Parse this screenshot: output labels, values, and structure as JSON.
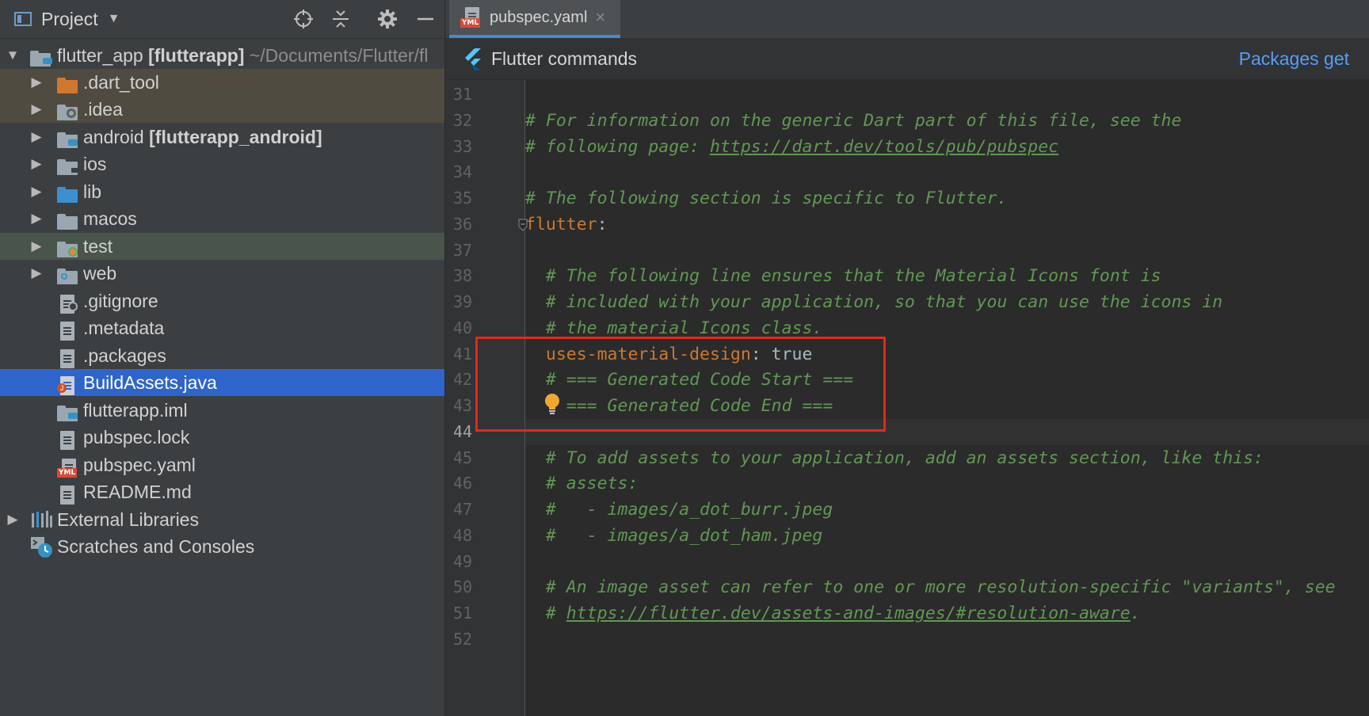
{
  "project_panel": {
    "title": "Project",
    "tools": [
      "locate-icon",
      "collapse-all-icon",
      "settings-icon",
      "hide-icon"
    ],
    "tree": [
      {
        "name": "flutter_app",
        "bold": "[flutterapp]",
        "path": "~/Documents/Flutter/fl",
        "type": "module-folder",
        "expanded": true
      },
      {
        "name": ".dart_tool",
        "type": "folder-excluded"
      },
      {
        "name": ".idea",
        "type": "folder-settings"
      },
      {
        "name": "android",
        "bold": "[flutterapp_android]",
        "type": "module-folder"
      },
      {
        "name": "ios",
        "type": "folder"
      },
      {
        "name": "lib",
        "type": "folder-source"
      },
      {
        "name": "macos",
        "type": "folder"
      },
      {
        "name": "test",
        "type": "folder-test"
      },
      {
        "name": "web",
        "type": "folder-web"
      },
      {
        "name": ".gitignore",
        "type": "file-ignore"
      },
      {
        "name": ".metadata",
        "type": "file"
      },
      {
        "name": ".packages",
        "type": "file"
      },
      {
        "name": "BuildAssets.java",
        "type": "file-java",
        "selected": true
      },
      {
        "name": "flutterapp.iml",
        "type": "file-iml"
      },
      {
        "name": "pubspec.lock",
        "type": "file"
      },
      {
        "name": "pubspec.yaml",
        "type": "file-yaml"
      },
      {
        "name": "README.md",
        "type": "file"
      },
      {
        "name": "External Libraries",
        "type": "libraries"
      },
      {
        "name": "Scratches and Consoles",
        "type": "scratches"
      }
    ]
  },
  "editor": {
    "tab": {
      "label": "pubspec.yaml",
      "badge": "YML",
      "close": "×"
    },
    "flutter_bar": {
      "title": "Flutter commands",
      "action": "Packages get"
    },
    "current_line": "44",
    "lines": [
      {
        "n": "31",
        "text": ""
      },
      {
        "n": "32",
        "text": "# For information on the generic Dart part of this file, see the"
      },
      {
        "n": "33",
        "text": "# following page: ",
        "link": "https://dart.dev/tools/pub/pubspec"
      },
      {
        "n": "34",
        "text": ""
      },
      {
        "n": "35",
        "text": "# The following section is specific to Flutter."
      },
      {
        "n": "36",
        "key": "flutter",
        "sep": ":"
      },
      {
        "n": "37",
        "text": ""
      },
      {
        "n": "38",
        "text": "  # The following line ensures that the Material Icons font is"
      },
      {
        "n": "39",
        "text": "  # included with your application, so that you can use the icons in"
      },
      {
        "n": "40",
        "text": "  # the material Icons class."
      },
      {
        "n": "41",
        "indent": "  ",
        "key": "uses-material-design",
        "sep": ": ",
        "value": "true"
      },
      {
        "n": "42",
        "text": "  # === Generated Code Start ==="
      },
      {
        "n": "43",
        "text": "    === Generated Code End ==="
      },
      {
        "n": "44",
        "text": ""
      },
      {
        "n": "45",
        "text": "  # To add assets to your application, add an assets section, like this:"
      },
      {
        "n": "46",
        "text": "  # assets:"
      },
      {
        "n": "47",
        "text": "  #   - images/a_dot_burr.jpeg"
      },
      {
        "n": "48",
        "text": "  #   - images/a_dot_ham.jpeg"
      },
      {
        "n": "49",
        "text": ""
      },
      {
        "n": "50",
        "text": "  # An image asset can refer to one or more resolution-specific \"variants\", see"
      },
      {
        "n": "51",
        "text": "  # ",
        "link": "https://flutter.dev/assets-and-images/#resolution-aware",
        "tail": "."
      },
      {
        "n": "52",
        "text": ""
      }
    ]
  },
  "colors": {
    "selection": "#2f65ca",
    "highlight_box": "#e02a1e",
    "comment": "#629755",
    "key": "#cc7832",
    "link": "#589df6"
  }
}
